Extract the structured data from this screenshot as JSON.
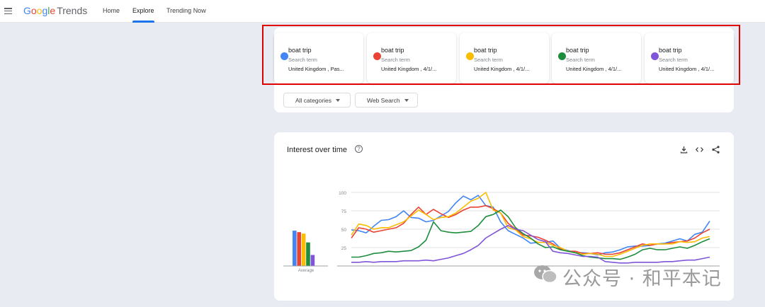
{
  "header": {
    "logo": {
      "g": "G",
      "o1": "o",
      "o2": "o",
      "g2": "g",
      "l": "l",
      "e": "e",
      "trends": "Trends"
    },
    "nav": [
      {
        "label": "Home"
      },
      {
        "label": "Explore"
      },
      {
        "label": "Trending Now"
      }
    ]
  },
  "terms": [
    {
      "name": "boat trip",
      "type": "Search term",
      "region": "United Kingdom , Pas...",
      "color": "#4285f4"
    },
    {
      "name": "boat trip",
      "type": "Search term",
      "region": "United Kingdom , 4/1/...",
      "color": "#ea4335"
    },
    {
      "name": "boat trip",
      "type": "Search term",
      "region": "United Kingdom , 4/1/...",
      "color": "#fbbc04"
    },
    {
      "name": "boat trip",
      "type": "Search term",
      "region": "United Kingdom , 4/1/...",
      "color": "#1e8e3e"
    },
    {
      "name": "boat trip",
      "type": "Search term",
      "region": "United Kingdom , 4/1/...",
      "color": "#7f56d9"
    }
  ],
  "filters": {
    "category": "All categories",
    "search_type": "Web Search"
  },
  "chart_panel": {
    "title": "Interest over time",
    "help": "?"
  },
  "watermark": {
    "text": "公众号 · 和平本记"
  },
  "chart_data": {
    "type": "line",
    "title": "Interest over time",
    "ylim": [
      0,
      100
    ],
    "yticks": [
      "100",
      "75",
      "50",
      "25"
    ],
    "grid": true,
    "average_label": "Average",
    "averages": [
      {
        "color": "#4285f4",
        "value": 48
      },
      {
        "color": "#ea4335",
        "value": 46
      },
      {
        "color": "#fbbc04",
        "value": 44
      },
      {
        "color": "#1e8e3e",
        "value": 32
      },
      {
        "color": "#7f56d9",
        "value": 15
      }
    ],
    "x": [
      0,
      1,
      2,
      3,
      4,
      5,
      6,
      7,
      8,
      9,
      10,
      11,
      12,
      13,
      14,
      15,
      16,
      17,
      18,
      19,
      20,
      21,
      22,
      23,
      24,
      25,
      26,
      27,
      28,
      29,
      30,
      31,
      32,
      33,
      34,
      35,
      36,
      37,
      38,
      39,
      40,
      41,
      42,
      43,
      44,
      45,
      46,
      47,
      48
    ],
    "series": [
      {
        "color": "#4285f4",
        "values": [
          49,
          48,
          45,
          54,
          62,
          63,
          67,
          75,
          66,
          65,
          60,
          62,
          68,
          74,
          86,
          95,
          90,
          96,
          82,
          80,
          60,
          48,
          43,
          38,
          31,
          32,
          32,
          34,
          24,
          21,
          18,
          18,
          17,
          15,
          18,
          19,
          22,
          26,
          27,
          27,
          28,
          30,
          31,
          34,
          37,
          34,
          43,
          46,
          61
        ]
      },
      {
        "color": "#ea4335",
        "values": [
          38,
          52,
          50,
          46,
          48,
          50,
          52,
          58,
          70,
          80,
          70,
          77,
          71,
          66,
          70,
          76,
          80,
          80,
          82,
          78,
          72,
          58,
          50,
          42,
          41,
          39,
          35,
          30,
          23,
          20,
          20,
          17,
          17,
          18,
          16,
          16,
          18,
          22,
          26,
          30,
          28,
          30,
          30,
          32,
          33,
          34,
          38,
          45,
          50
        ]
      },
      {
        "color": "#fbbc04",
        "values": [
          42,
          57,
          55,
          50,
          52,
          52,
          56,
          60,
          68,
          76,
          70,
          63,
          66,
          67,
          72,
          80,
          88,
          92,
          100,
          76,
          72,
          52,
          49,
          40,
          37,
          32,
          32,
          28,
          25,
          20,
          18,
          16,
          17,
          16,
          13,
          13,
          16,
          20,
          24,
          28,
          30,
          30,
          30,
          30,
          33,
          32,
          33,
          38,
          40
        ]
      },
      {
        "color": "#1e8e3e",
        "values": [
          12,
          12,
          14,
          17,
          18,
          20,
          19,
          20,
          21,
          26,
          35,
          60,
          48,
          46,
          45,
          46,
          47,
          55,
          67,
          70,
          76,
          67,
          52,
          44,
          38,
          30,
          25,
          26,
          22,
          20,
          18,
          14,
          12,
          11,
          10,
          10,
          9,
          12,
          16,
          22,
          24,
          22,
          22,
          24,
          26,
          24,
          28,
          33,
          37
        ]
      },
      {
        "color": "#7f56d9",
        "values": [
          5,
          5,
          6,
          5,
          6,
          6,
          6,
          7,
          7,
          7,
          8,
          7,
          9,
          11,
          14,
          17,
          22,
          28,
          38,
          44,
          50,
          55,
          50,
          48,
          42,
          36,
          33,
          20,
          18,
          17,
          15,
          13,
          13,
          12,
          6,
          5,
          4,
          4,
          5,
          5,
          5,
          5,
          6,
          6,
          7,
          8,
          8,
          10,
          12
        ]
      }
    ]
  }
}
